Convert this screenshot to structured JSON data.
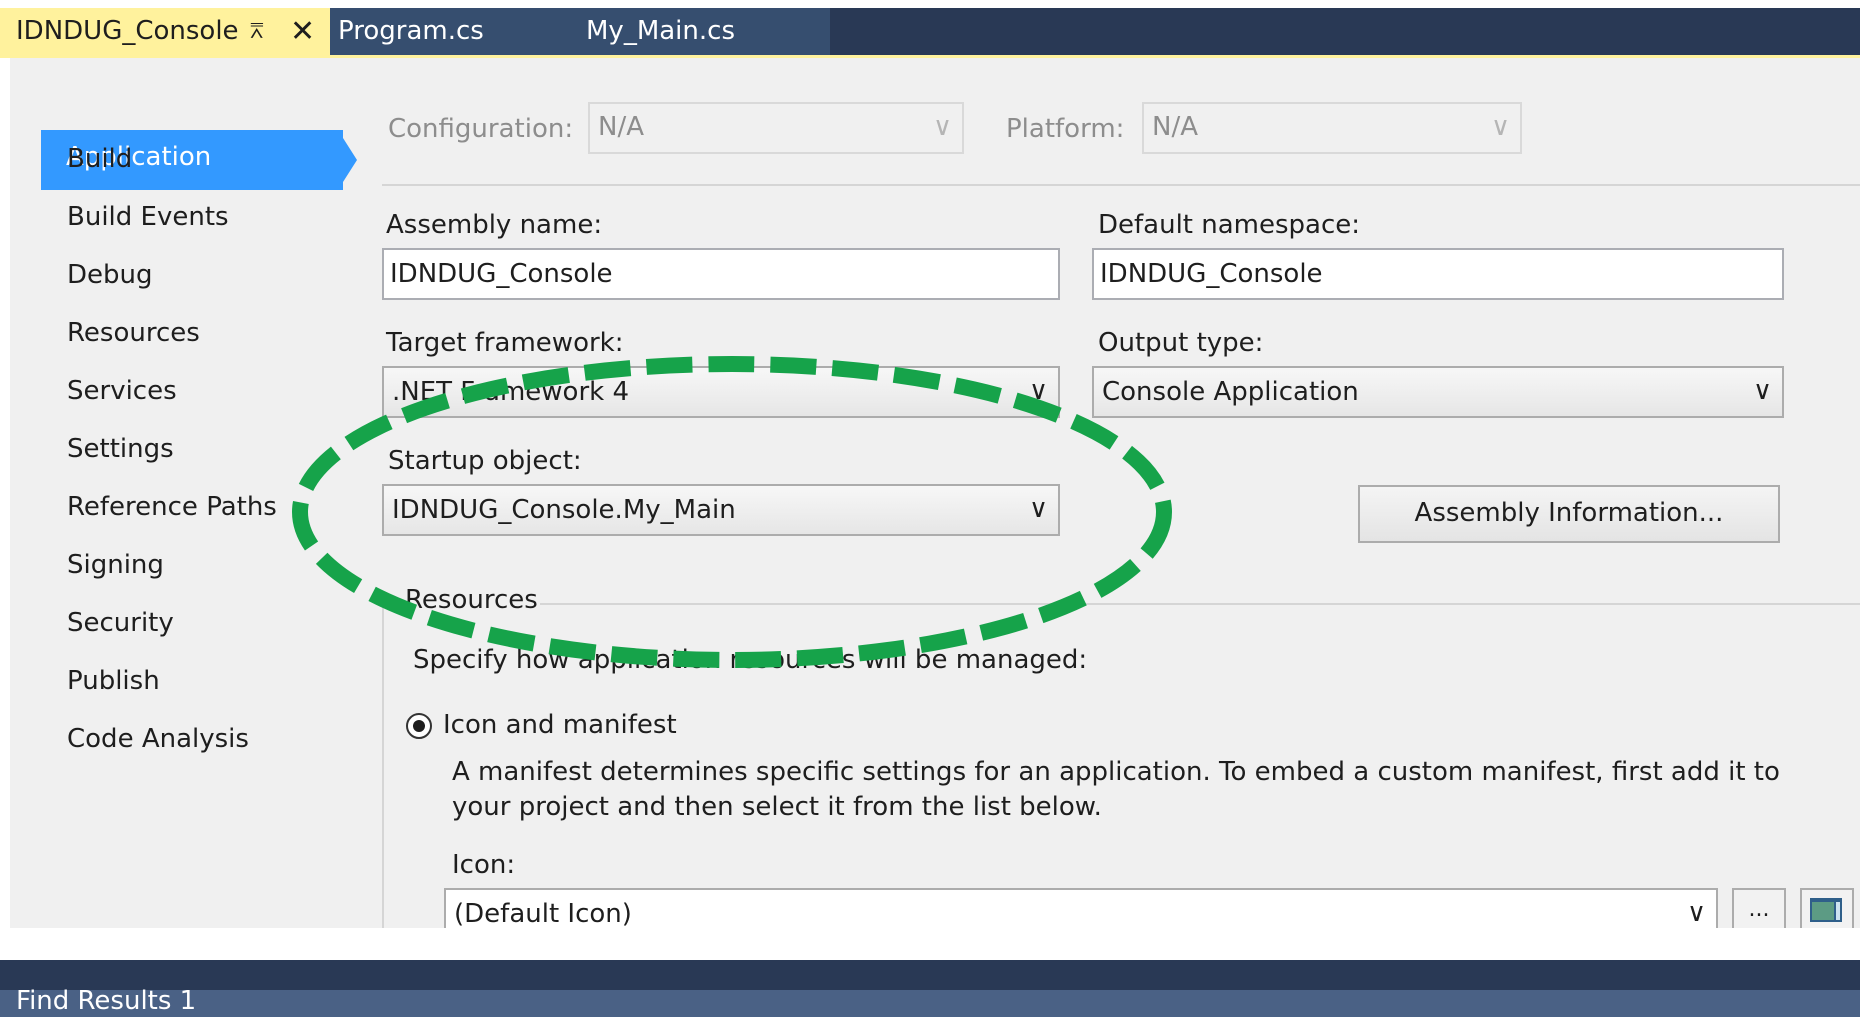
{
  "tabs": [
    {
      "label": "IDNDUG_Console",
      "active": true
    },
    {
      "label": "Program.cs",
      "active": false
    },
    {
      "label": "My_Main.cs",
      "active": false
    }
  ],
  "nav": {
    "active": "Application",
    "items": [
      "Build",
      "Build Events",
      "Debug",
      "Resources",
      "Services",
      "Settings",
      "Reference Paths",
      "Signing",
      "Security",
      "Publish",
      "Code Analysis"
    ]
  },
  "config": {
    "configuration_label": "Configuration:",
    "configuration_value": "N/A",
    "platform_label": "Platform:",
    "platform_value": "N/A"
  },
  "app": {
    "assembly_name_label": "Assembly name:",
    "assembly_name": "IDNDUG_Console",
    "default_namespace_label": "Default namespace:",
    "default_namespace": "IDNDUG_Console",
    "target_framework_label": "Target framework:",
    "target_framework": ".NET Framework 4",
    "output_type_label": "Output type:",
    "output_type": "Console Application",
    "startup_object_label": "Startup object:",
    "startup_object": "IDNDUG_Console.My_Main",
    "assembly_info_button": "Assembly Information..."
  },
  "resources": {
    "group_title": "Resources",
    "description": "Specify how application resources will be managed:",
    "option_label": "Icon and manifest",
    "manifest_line1": "A manifest determines specific settings for an application. To embed a custom manifest, first add it to",
    "manifest_line2": "your project and then select it from the list below.",
    "icon_label": "Icon:",
    "icon_value": "(Default Icon)",
    "browse_label": "..."
  },
  "bottom": {
    "find_results": "Find Results 1"
  },
  "colors": {
    "annotation": "#16a34a",
    "nav_highlight": "#3399ff",
    "active_tab": "#fff29d"
  }
}
